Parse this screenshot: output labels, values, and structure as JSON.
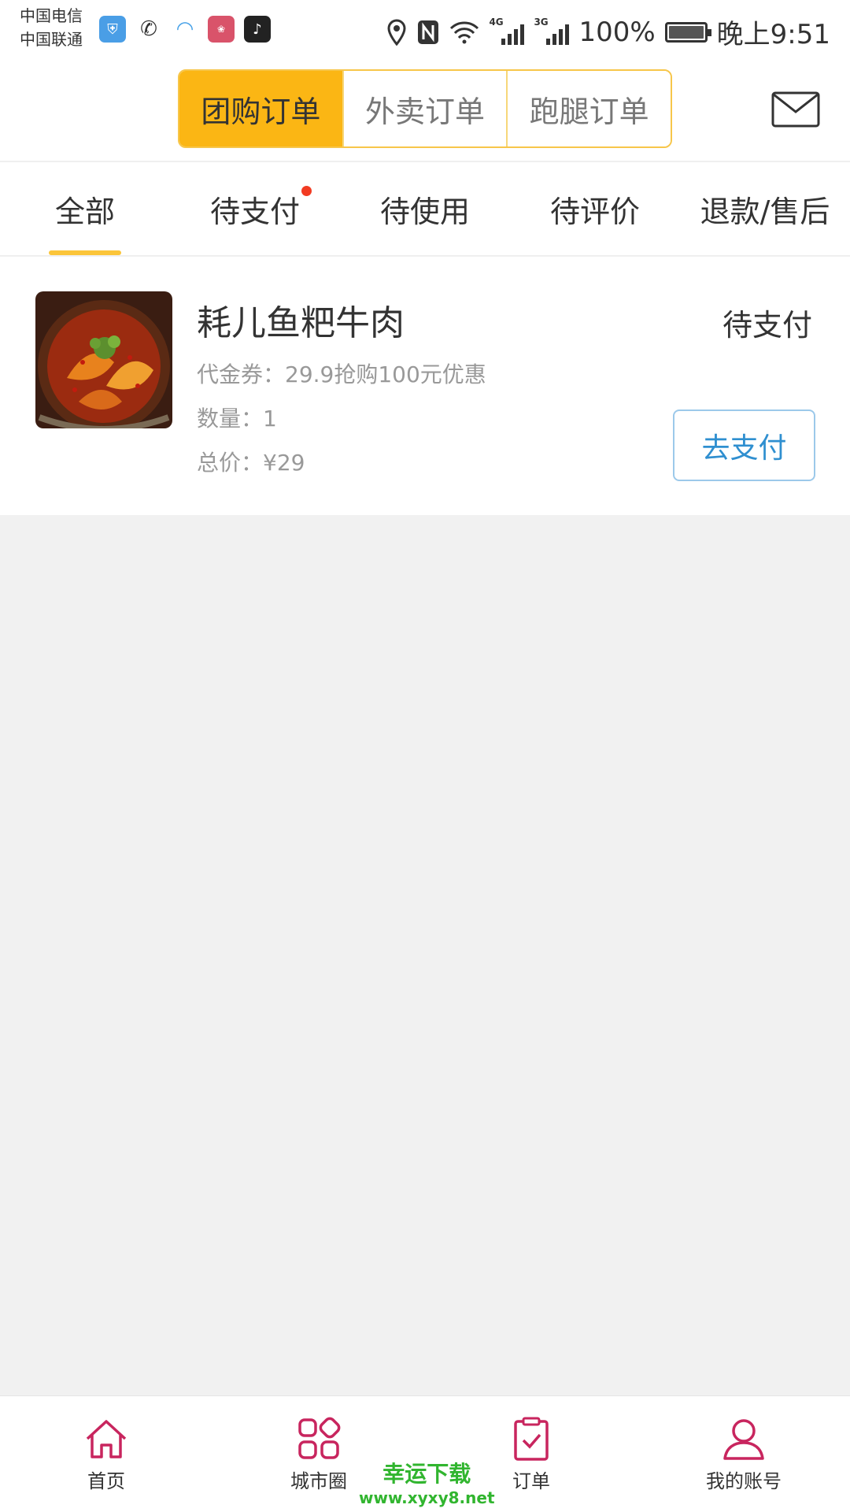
{
  "status_bar": {
    "carrier1": "中国电信",
    "carrier2": "中国联通",
    "network1": "4G",
    "network2": "3G",
    "battery_text": "100%",
    "battery_level": 1.0,
    "time": "晚上9:51"
  },
  "header": {
    "segments": [
      "团购订单",
      "外卖订单",
      "跑腿订单"
    ],
    "active_segment": 0,
    "accent_color": "#fbb614"
  },
  "tabs": {
    "items": [
      "全部",
      "待支付",
      "待使用",
      "待评价",
      "退款/售后"
    ],
    "active": 0,
    "badge_on": 1
  },
  "order": {
    "title": "耗儿鱼粑牛肉",
    "status": "待支付",
    "voucher": "代金券：29.9抢购100元优惠",
    "quantity": "数量：1",
    "total": "总价：¥29",
    "pay_button": "去支付"
  },
  "bottom_nav": {
    "items": [
      {
        "label": "首页",
        "icon": "home-icon"
      },
      {
        "label": "城市圈",
        "icon": "grid-icon"
      },
      {
        "label": "订单",
        "icon": "clipboard-check-icon"
      },
      {
        "label": "我的账号",
        "icon": "user-icon"
      }
    ],
    "icon_color": "#c8255e"
  },
  "watermark": {
    "line1": "幸运下载",
    "line2": "www.xyxy8.net"
  }
}
